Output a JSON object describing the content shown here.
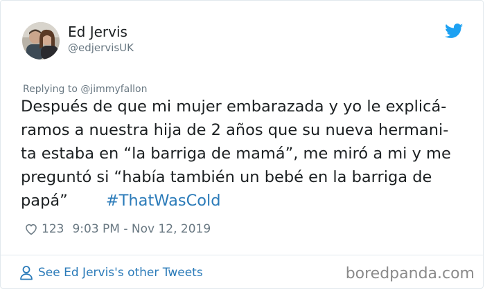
{
  "tweet": {
    "author": {
      "display_name": "Ed Jervis",
      "handle": "@edjervisUK"
    },
    "replying_prefix": "Replying to ",
    "replying_to": "@jimmyfallon",
    "text_lines": [
      "Después de que mi mujer embarazada y yo le explicá-",
      "ramos a nuestra hija de 2 años que su nueva hermani-",
      "ta estaba en “la barriga de mamá”, me miró a mi y me",
      "preguntó si “había también un bebé en la barriga de",
      "papá”"
    ],
    "hashtag": "#ThatWasCold",
    "likes": "123",
    "timestamp": "9:03 PM - Nov 12, 2019"
  },
  "footer": {
    "more_tweets_label": "See Ed Jervis's other Tweets"
  },
  "watermark": "boredpanda.com",
  "icons": {
    "brand": "twitter-bird-icon",
    "like": "heart-icon",
    "profile": "person-icon"
  },
  "colors": {
    "link": "#2b7bb9",
    "twitter_blue": "#1da1f2",
    "secondary_text": "#697882"
  }
}
